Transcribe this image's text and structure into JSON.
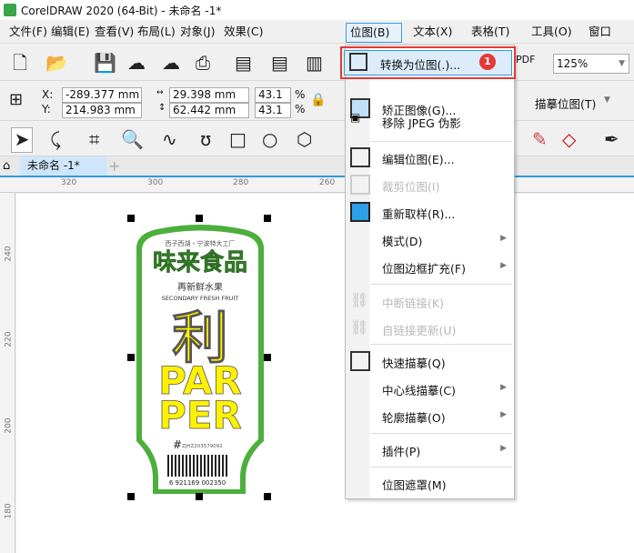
{
  "window": {
    "title": "CorelDRAW 2020 (64-Bit) - 未命名 -1*"
  },
  "menubar": [
    "文件(F)",
    "编辑(E)",
    "查看(V)",
    "布局(L)",
    "对象(J)",
    "效果(C)",
    "位图(B)",
    "文本(X)",
    "表格(T)",
    "工具(O)",
    "窗口(W)"
  ],
  "toolbar": {
    "zoom": "125%",
    "pdf": "PDF"
  },
  "property_bar": {
    "x_label": "X:",
    "y_label": "Y:",
    "x": "-289.377 mm",
    "y": "214.983 mm",
    "width": "29.398 mm",
    "height": "62.442 mm",
    "scale_x": "43.1",
    "scale_y": "43.1",
    "pct": "%",
    "trace_bitmap": "描摹位图(T)"
  },
  "doc_tab": "未命名 -1*",
  "ruler": {
    "h": [
      "320",
      "300",
      "280",
      "260"
    ],
    "v": [
      "240",
      "220",
      "200",
      "180"
    ]
  },
  "bitmap_menu": {
    "items": [
      {
        "label": "转换为位图(.)...",
        "enabled": true,
        "highlighted": true,
        "badge": "1"
      },
      {
        "label": "矫正图像(G)...",
        "enabled": true
      },
      {
        "label": "移除 JPEG 伪影",
        "enabled": true
      },
      {
        "label": "编辑位图(E)...",
        "enabled": true
      },
      {
        "label": "裁剪位图(I)",
        "enabled": false
      },
      {
        "label": "重新取样(R)...",
        "enabled": true
      },
      {
        "label": "模式(D)",
        "enabled": true,
        "submenu": true
      },
      {
        "label": "位图边框扩充(F)",
        "enabled": true,
        "submenu": true
      },
      {
        "label": "中断链接(K)",
        "enabled": false
      },
      {
        "label": "自链接更新(U)",
        "enabled": false
      },
      {
        "label": "快速描摹(Q)",
        "enabled": true
      },
      {
        "label": "中心线描摹(C)",
        "enabled": true,
        "submenu": true
      },
      {
        "label": "轮廓描摹(O)",
        "enabled": true,
        "submenu": true
      },
      {
        "label": "插件(P)",
        "enabled": true,
        "submenu": true
      },
      {
        "label": "位图遮罩(M)",
        "enabled": true
      }
    ]
  },
  "label_art": {
    "top": "西子西湖・宁波特大工厂",
    "brand": "味来食品",
    "sub": "再新鲜水果",
    "en": "SECONDARY FRESH FRUIT",
    "big1": "利",
    "big2": "PAR",
    "big3": "PER",
    "code": "ZJHZ203579092",
    "barcode": "6 921169 002350",
    "colors": {
      "green": "#4caf3c",
      "yellow": "#fff200"
    }
  },
  "colors": {
    "highlight_border": "#e53935",
    "accent": "#2a9be0"
  }
}
